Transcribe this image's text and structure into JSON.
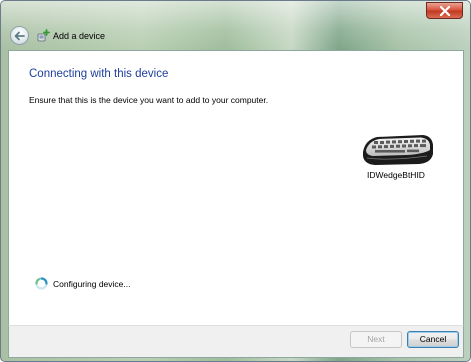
{
  "window": {
    "title": "Add a device"
  },
  "main": {
    "heading": "Connecting with this device",
    "instruction": "Ensure that this is the device you want to add to your computer.",
    "device": {
      "name": "IDWedgeBtHID",
      "icon": "keyboard-icon"
    },
    "status_text": "Configuring device..."
  },
  "buttons": {
    "next_label": "Next",
    "next_enabled": false,
    "cancel_label": "Cancel"
  },
  "colors": {
    "heading": "#1e3e9a",
    "close_button": "#c23a22",
    "default_button_border": "#3c7fb1"
  }
}
